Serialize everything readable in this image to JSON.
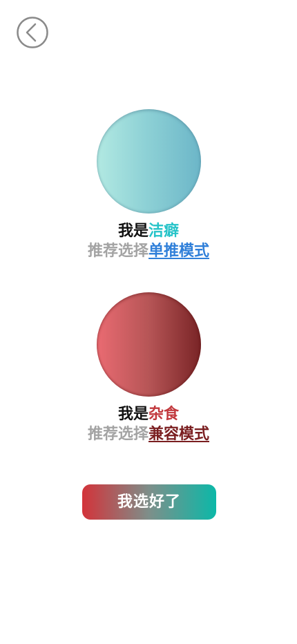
{
  "nav": {
    "back_icon": "chevron-left-in-circle"
  },
  "options": [
    {
      "prefix": "我是",
      "type_label": "洁癖",
      "recommend_prefix": "推荐选择",
      "mode_label": "单推模式",
      "type_color": "#25c3c8",
      "mode_color": "#2f7fd9",
      "orb_colors": [
        "#b2e9e2",
        "#6cb6c8"
      ]
    },
    {
      "prefix": "我是",
      "type_label": "杂食",
      "recommend_prefix": "推荐选择",
      "mode_label": "兼容模式",
      "type_color": "#c2393d",
      "mode_color": "#7a1e20",
      "orb_colors": [
        "#ea6b72",
        "#792426"
      ]
    }
  ],
  "confirm": {
    "label": "我选好了",
    "gradient": [
      "#d3333a",
      "#0cb8a8"
    ]
  }
}
